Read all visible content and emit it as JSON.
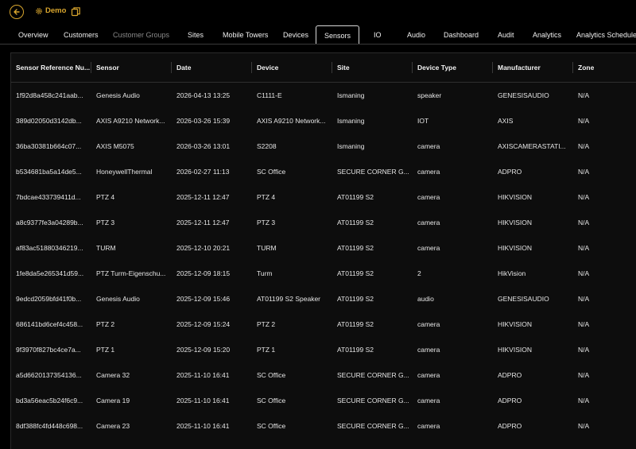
{
  "header": {
    "org_name": "Demo",
    "back_icon": "arrow-left-icon",
    "org_icon": "gear-icon",
    "copy_icon": "copy-icon",
    "accent_color": "#d9a62e"
  },
  "tabs": [
    {
      "label": "Overview"
    },
    {
      "label": "Customers"
    },
    {
      "label": "Customer Groups"
    },
    {
      "label": "Sites"
    },
    {
      "label": "Mobile Towers"
    },
    {
      "label": "Devices"
    },
    {
      "label": "Sensors"
    },
    {
      "label": "IO"
    },
    {
      "label": "Audio"
    },
    {
      "label": "Dashboard"
    },
    {
      "label": "Audit"
    },
    {
      "label": "Analytics"
    },
    {
      "label": "Analytics Schedule"
    }
  ],
  "active_tab": "Sensors",
  "table": {
    "columns": [
      "Sensor Reference Nu...",
      "Sensor",
      "Date",
      "Device",
      "Site",
      "Device Type",
      "Manufacturer",
      "Zone"
    ],
    "rows": [
      [
        "1f92d8a458c241aab...",
        "Genesis Audio",
        "2026-04-13 13:25",
        "C1111-E",
        "Ismaning",
        "speaker",
        "GENESISAUDIO",
        "N/A"
      ],
      [
        "389d02050d3142db...",
        "AXIS A9210 Network...",
        "2026-03-26 15:39",
        "AXIS A9210 Network...",
        "Ismaning",
        "IOT",
        "AXIS",
        "N/A"
      ],
      [
        "36ba30381b664c07...",
        "AXIS M5075",
        "2026-03-26 13:01",
        "S2208",
        "Ismaning",
        "camera",
        "AXISCAMERASTATI...",
        "N/A"
      ],
      [
        "b534681ba5a14de5...",
        "HoneywellThermal",
        "2026-02-27 11:13",
        "SC Office",
        "SECURE CORNER G...",
        "camera",
        "ADPRO",
        "N/A"
      ],
      [
        "7bdcae433739411d...",
        "PTZ 4",
        "2025-12-11 12:47",
        "PTZ 4",
        "AT01199 S2",
        "camera",
        "HIKVISION",
        "N/A"
      ],
      [
        "a8c9377fe3a04289b...",
        "PTZ 3",
        "2025-12-11 12:47",
        "PTZ 3",
        "AT01199 S2",
        "camera",
        "HIKVISION",
        "N/A"
      ],
      [
        "af83ac51880346219...",
        "TURM",
        "2025-12-10 20:21",
        "TURM",
        "AT01199 S2",
        "camera",
        "HIKVISION",
        "N/A"
      ],
      [
        "1fe8da5e265341d59...",
        "PTZ Turm-Eigenschu...",
        "2025-12-09 18:15",
        "Turm",
        "AT01199 S2",
        "2",
        "HikVision",
        "N/A"
      ],
      [
        "9edcd2059bfd41f0b...",
        "Genesis Audio",
        "2025-12-09 15:46",
        "AT01199 S2 Speaker",
        "AT01199 S2",
        "audio",
        "GENESISAUDIO",
        "N/A"
      ],
      [
        "686141bd6cef4c458...",
        "PTZ 2",
        "2025-12-09 15:24",
        "PTZ 2",
        "AT01199 S2",
        "camera",
        "HIKVISION",
        "N/A"
      ],
      [
        "9f3970f827bc4ce7a...",
        "PTZ 1",
        "2025-12-09 15:20",
        "PTZ 1",
        "AT01199 S2",
        "camera",
        "HIKVISION",
        "N/A"
      ],
      [
        "a5d6620137354136...",
        "Camera 32",
        "2025-11-10 16:41",
        "SC Office",
        "SECURE CORNER G...",
        "camera",
        "ADPRO",
        "N/A"
      ],
      [
        "bd3a56eac5b24f6c9...",
        "Camera 19",
        "2025-11-10 16:41",
        "SC Office",
        "SECURE CORNER G...",
        "camera",
        "ADPRO",
        "N/A"
      ],
      [
        "8df388fc4fd448c698...",
        "Camera 23",
        "2025-11-10 16:41",
        "SC Office",
        "SECURE CORNER G...",
        "camera",
        "ADPRO",
        "N/A"
      ]
    ]
  }
}
